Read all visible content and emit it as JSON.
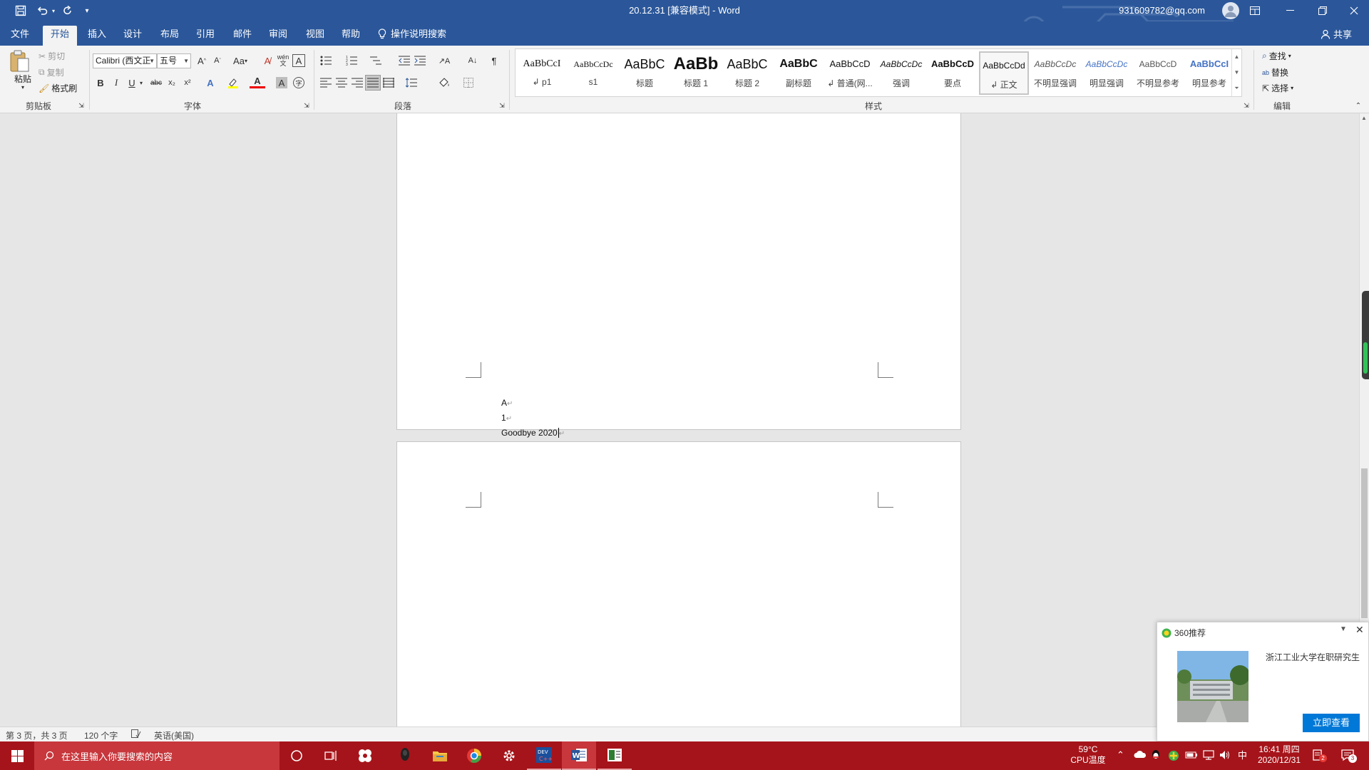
{
  "title_bar": {
    "document_title": "20.12.31 [兼容模式] - Word",
    "account_email": "931609782@qq.com"
  },
  "menu": {
    "tabs": [
      "文件",
      "开始",
      "插入",
      "设计",
      "布局",
      "引用",
      "邮件",
      "审阅",
      "视图",
      "帮助"
    ],
    "active_tab": "开始",
    "tell_me": "操作说明搜索",
    "share": "共享"
  },
  "ribbon": {
    "clipboard": {
      "paste": "粘贴",
      "cut": "剪切",
      "copy": "复制",
      "format_painter": "格式刷",
      "group_label": "剪贴板"
    },
    "font": {
      "font_name": "Calibri (西文正",
      "font_size": "五号",
      "change_case": "Aa",
      "wen": "wén",
      "group_label": "字体",
      "bold": "B",
      "italic": "I",
      "underline": "U",
      "strike": "abc",
      "sub": "x₂",
      "sup": "x²",
      "a_letter": "A",
      "a_color": "A",
      "a_shade": "A",
      "enclose": "字"
    },
    "paragraph": {
      "group_label": "段落"
    },
    "styles": {
      "group_label": "样式",
      "items": [
        {
          "preview": "AaBbCcI",
          "name": "↲ p1"
        },
        {
          "preview": "AaBbCcDc",
          "name": "s1"
        },
        {
          "preview": "AaBbC",
          "name": "标题"
        },
        {
          "preview": "AaBb",
          "name": "标题 1"
        },
        {
          "preview": "AaBbC",
          "name": "标题 2"
        },
        {
          "preview": "AaBbC",
          "name": "副标题"
        },
        {
          "preview": "AaBbCcD",
          "name": "↲ 普通(网..."
        },
        {
          "preview": "AaBbCcDc",
          "name": "强调"
        },
        {
          "preview": "AaBbCcD",
          "name": "要点"
        },
        {
          "preview": "AaBbCcDd",
          "name": "↲ 正文"
        },
        {
          "preview": "AaBbCcDc",
          "name": "不明显强调"
        },
        {
          "preview": "AaBbCcDc",
          "name": "明显强调"
        },
        {
          "preview": "AaBbCcD",
          "name": "不明显参考"
        },
        {
          "preview": "AaBbCcI",
          "name": "明显参考"
        }
      ],
      "active": "↲ 正文"
    },
    "editing": {
      "find": "查找",
      "replace": "替换",
      "select": "选择",
      "group_label": "编辑"
    }
  },
  "document": {
    "lines": [
      "A",
      "1",
      "Goodbye 2020"
    ],
    "para_mark": "↵"
  },
  "status_bar": {
    "page": "第 3 页，共 3 页",
    "words": "120 个字",
    "language": "英语(美国)"
  },
  "popup": {
    "title": "360推荐",
    "headline": "浙江工业大学在职研究生",
    "button": "立即查看"
  },
  "taskbar": {
    "search_placeholder": "在这里输入你要搜索的内容",
    "temp": "59°C",
    "temp_label": "CPU温度",
    "ime": "中",
    "time": "16:41 周四",
    "date": "2020/12/31",
    "notif_badge": "2",
    "action_badge": "3"
  },
  "colors": {
    "word_blue": "#2b579a",
    "taskbar_red": "#a5141a",
    "button_blue": "#0078d7"
  }
}
